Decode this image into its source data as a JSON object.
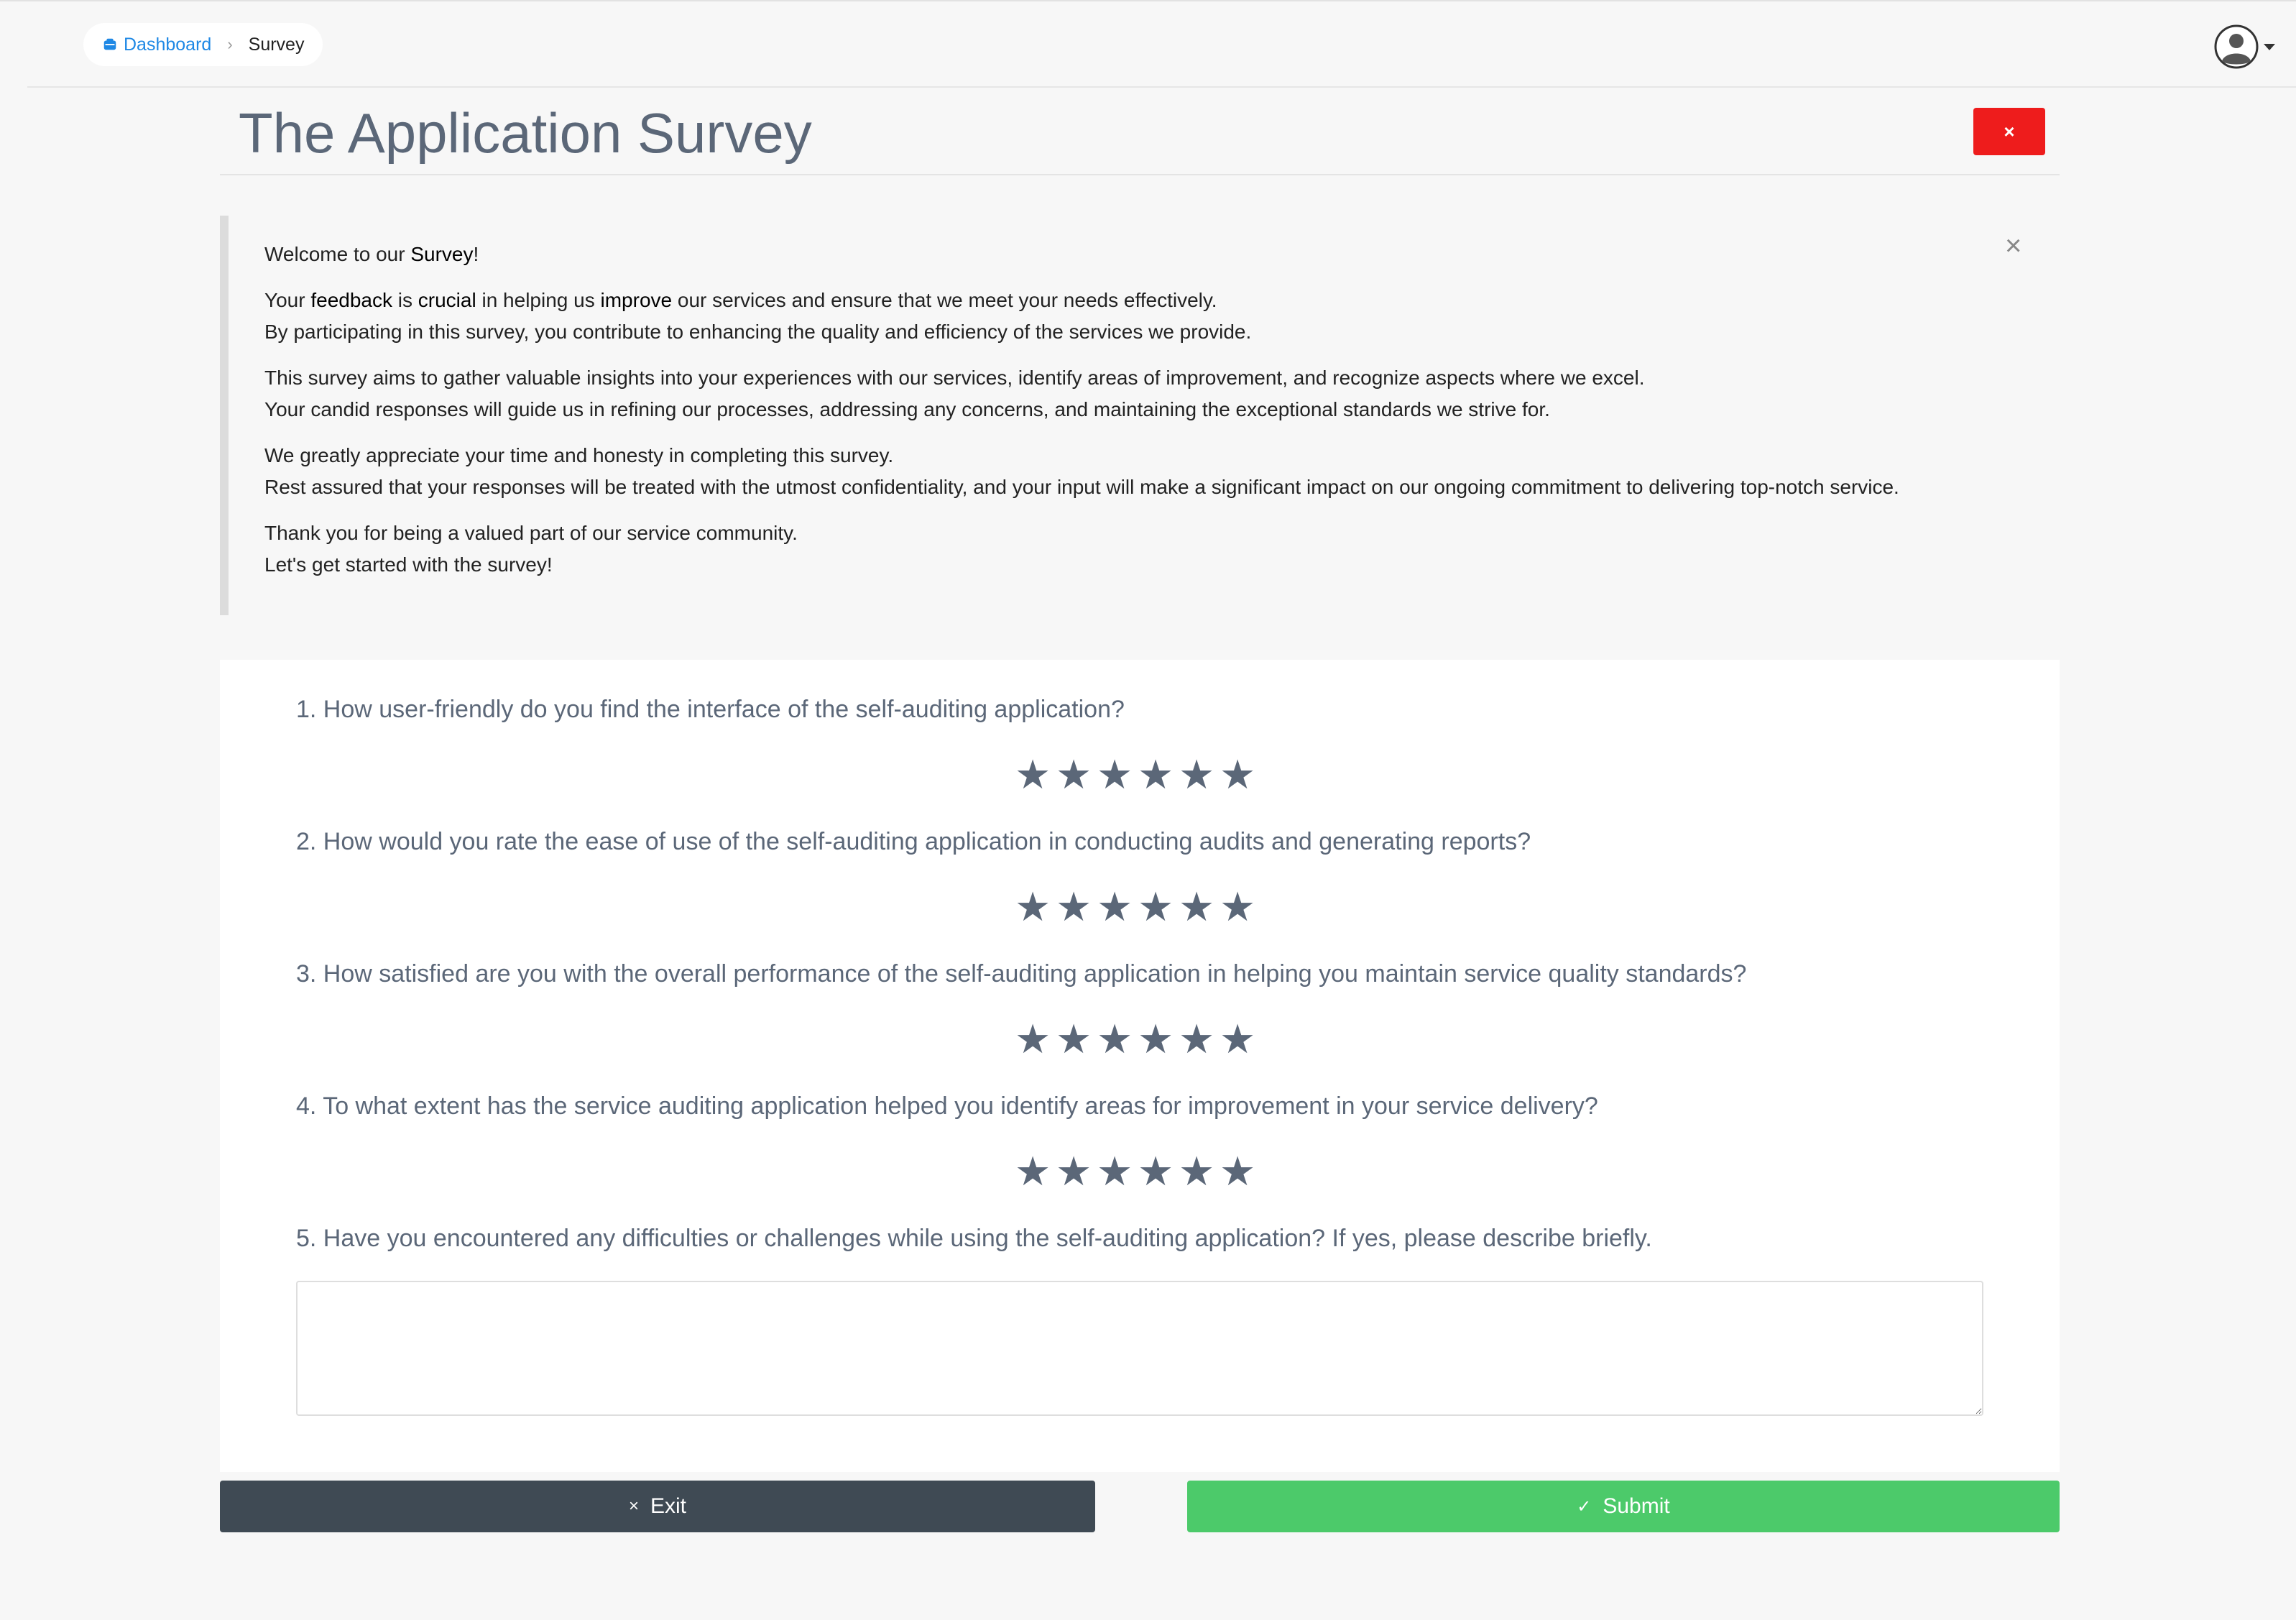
{
  "breadcrumb": {
    "home_icon": "home-icon",
    "home_label": "Dashboard",
    "separator": "›",
    "current_label": "Survey"
  },
  "user_menu": {
    "icon": "user-avatar-icon"
  },
  "header": {
    "title": "The Application Survey",
    "close_label": "×"
  },
  "intro": {
    "dismiss_label": "×",
    "welcome_pre": "Welcome to our ",
    "welcome_bold": "Survey",
    "welcome_post": "!",
    "p1_a": "Your ",
    "p1_b": "feedback",
    "p1_c": " is ",
    "p1_d": "crucial",
    "p1_e": " in helping us ",
    "p1_f": "improve",
    "p1_g": " our services and ensure that we meet your needs effectively.",
    "p1_line2": "By participating in this survey, you contribute to enhancing the quality and efficiency of the services we provide.",
    "p2_line1": "This survey aims to gather valuable insights into your experiences with our services, identify areas of improvement, and recognize aspects where we excel.",
    "p2_line2": "Your candid responses will guide us in refining our processes, addressing any concerns, and maintaining the exceptional standards we strive for.",
    "p3_line1": "We greatly appreciate your time and honesty in completing this survey.",
    "p3_line2": "Rest assured that your responses will be treated with the utmost confidentiality, and your input will make a significant impact on our ongoing commitment to delivering top-notch service.",
    "p4_line1": "Thank you for being a valued part of our service community.",
    "p4_line2": "Let's get started with the survey!"
  },
  "questions": [
    {
      "text": "1. How user-friendly do you find the interface of the self-auditing application?",
      "type": "rating",
      "stars": 6
    },
    {
      "text": "2. How would you rate the ease of use of the self-auditing application in conducting audits and generating reports?",
      "type": "rating",
      "stars": 6
    },
    {
      "text": "3. How satisfied are you with the overall performance of the self-auditing application in helping you maintain service quality standards?",
      "type": "rating",
      "stars": 6
    },
    {
      "text": "4. To what extent has the service auditing application helped you identify areas for improvement in your service delivery?",
      "type": "rating",
      "stars": 6
    },
    {
      "text": "5. Have you encountered any difficulties or challenges while using the self-auditing application? If yes, please describe briefly.",
      "type": "text",
      "value": ""
    }
  ],
  "star_glyph": "★",
  "actions": {
    "exit_icon": "×",
    "exit_label": "Exit",
    "submit_icon": "✓",
    "submit_label": "Submit"
  },
  "colors": {
    "close_button": "#ee1c1c",
    "exit_button": "#3f4a54",
    "submit_button": "#4cca6a",
    "link": "#1e88e5",
    "question_text": "#5b6778"
  }
}
